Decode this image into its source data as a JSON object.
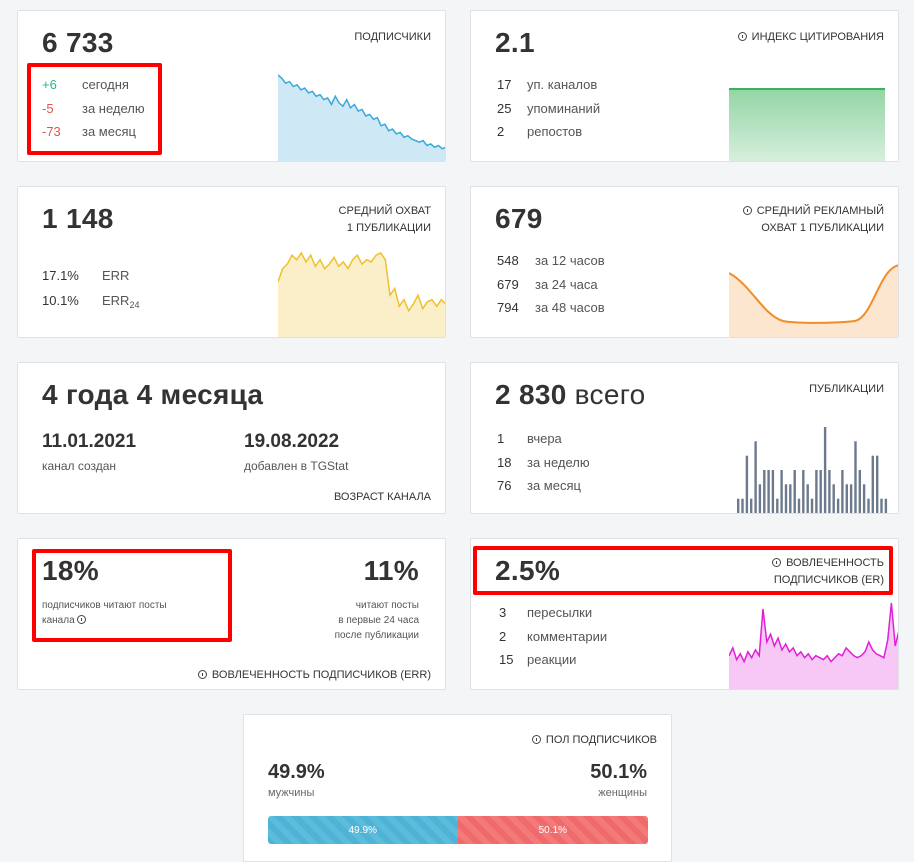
{
  "subscribers": {
    "value": "6 733",
    "label": "ПОДПИСЧИКИ",
    "rows": [
      {
        "num": "+6",
        "text": "сегодня",
        "tone": "green"
      },
      {
        "num": "-5",
        "text": "за неделю",
        "tone": "red"
      },
      {
        "num": "-73",
        "text": "за месяц",
        "tone": "red"
      }
    ],
    "chart_color": "#3aa8d8",
    "chart_values": [
      100,
      96,
      90,
      92,
      86,
      88,
      82,
      84,
      78,
      80,
      74,
      76,
      70,
      72,
      64,
      74,
      66,
      62,
      70,
      60,
      64,
      56,
      58,
      50,
      52,
      46,
      48,
      38,
      40,
      32,
      34,
      28,
      30,
      24,
      26,
      22,
      20,
      18,
      20,
      14,
      16,
      12,
      14,
      10,
      12
    ]
  },
  "citation": {
    "value": "2.1",
    "label": "ИНДЕКС ЦИТИРОВАНИЯ",
    "rows": [
      {
        "num": "17",
        "text": "уп. каналов"
      },
      {
        "num": "25",
        "text": "упоминаний"
      },
      {
        "num": "2",
        "text": "репостов"
      }
    ],
    "chart_color": "#3cb25a"
  },
  "reach": {
    "value": "1 148",
    "label_line1": "СРЕДНИЙ ОХВАТ",
    "label_line2": "1 ПУБЛИКАЦИИ",
    "rows": [
      {
        "num": "17.1%",
        "text": "ERR",
        "sub": ""
      },
      {
        "num": "10.1%",
        "text": "ERR",
        "sub": "24"
      }
    ],
    "chart_color": "#f0c02c",
    "chart_values": [
      46,
      58,
      62,
      70,
      66,
      72,
      64,
      70,
      60,
      66,
      58,
      62,
      68,
      60,
      64,
      58,
      66,
      70,
      62,
      66,
      64,
      70,
      72,
      66,
      34,
      40,
      24,
      30,
      20,
      26,
      34,
      22,
      28,
      30,
      24,
      30,
      26
    ]
  },
  "ad_reach": {
    "value": "679",
    "label_line1": "СРЕДНИЙ РЕКЛАМНЫЙ",
    "label_line2": "ОХВАТ 1 ПУБЛИКАЦИИ",
    "rows": [
      {
        "num": "548",
        "text": "за 12 часов"
      },
      {
        "num": "679",
        "text": "за 24 часа"
      },
      {
        "num": "794",
        "text": "за 48 часов"
      }
    ],
    "chart_color": "#f28c28"
  },
  "age": {
    "value": "4 года 4 месяца",
    "created_date": "11.01.2021",
    "created_label": "канал создан",
    "added_date": "19.08.2022",
    "added_label": "добавлен в TGStat",
    "label": "ВОЗРАСТ КАНАЛА"
  },
  "publications": {
    "value": "2 830",
    "unit": "всего",
    "label": "ПУБЛИКАЦИИ",
    "rows": [
      {
        "num": "1",
        "text": "вчера"
      },
      {
        "num": "18",
        "text": "за неделю"
      },
      {
        "num": "76",
        "text": "за месяц"
      }
    ],
    "chart_color": "#6b7a8c",
    "chart_values": [
      1,
      1,
      4,
      1,
      5,
      2,
      3,
      3,
      3,
      1,
      3,
      2,
      2,
      3,
      1,
      3,
      2,
      1,
      3,
      3,
      6,
      3,
      2,
      1,
      3,
      2,
      2,
      5,
      3,
      2,
      1,
      4,
      4,
      1,
      1
    ]
  },
  "err": {
    "value": "18%",
    "desc_line1": "подписчиков читают посты",
    "desc_line2": "канала",
    "value2": "11%",
    "desc2_line1": "читают посты",
    "desc2_line2": "в первые 24 часа",
    "desc2_line3": "после публикации",
    "label": "ВОВЛЕЧЕННОСТЬ ПОДПИСЧИКОВ (ERR)"
  },
  "er": {
    "value": "2.5%",
    "label_line1": "ВОВЛЕЧЕННОСТЬ",
    "label_line2": "ПОДПИСЧИКОВ (ER)",
    "rows": [
      {
        "num": "3",
        "text": "пересылки"
      },
      {
        "num": "2",
        "text": "комментарии"
      },
      {
        "num": "15",
        "text": "реакции"
      }
    ],
    "chart_color": "#e020d8",
    "chart_values": [
      30,
      38,
      26,
      32,
      24,
      34,
      28,
      36,
      30,
      78,
      44,
      52,
      40,
      48,
      36,
      42,
      34,
      38,
      30,
      34,
      28,
      32,
      26,
      30,
      28,
      26,
      30,
      24,
      28,
      32,
      30,
      38,
      34,
      30,
      28,
      30,
      34,
      44,
      36,
      32,
      30,
      28,
      46,
      84,
      40,
      56
    ]
  },
  "gender": {
    "label": "ПОЛ ПОДПИСЧИКОВ",
    "male_value": "49.9%",
    "male_label": "мужчины",
    "female_value": "50.1%",
    "female_label": "женщины",
    "male_share": 49.9,
    "female_share": 50.1,
    "male_bar_text": "49.9%",
    "female_bar_text": "50.1%"
  }
}
